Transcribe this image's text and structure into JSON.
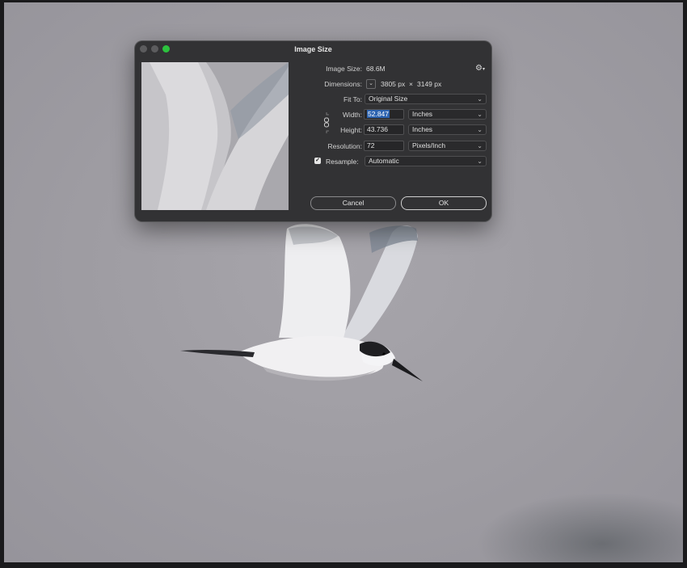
{
  "dialog": {
    "title": "Image Size",
    "image_size_label": "Image Size:",
    "image_size_value": "68.6M",
    "dimensions_label": "Dimensions:",
    "dimensions_width": "3805 px",
    "dimensions_times": "×",
    "dimensions_height": "3149 px",
    "fit_to_label": "Fit To:",
    "fit_to_value": "Original Size",
    "width_label": "Width:",
    "width_value": "52.847",
    "width_unit": "Inches",
    "height_label": "Height:",
    "height_value": "43.736",
    "height_unit": "Inches",
    "resolution_label": "Resolution:",
    "resolution_value": "72",
    "resolution_unit": "Pixels/Inch",
    "resample_label": "Resample:",
    "resample_value": "Automatic",
    "resample_checked": true,
    "cancel_label": "Cancel",
    "ok_label": "OK"
  },
  "icons": {
    "gear": "gear-icon",
    "chevron": "chevron-down-icon",
    "link": "link-chain-icon",
    "check": "checkmark-icon"
  },
  "colors": {
    "dialog_bg": "#323234",
    "selection": "#2c63b0",
    "zoom_button": "#2cc23e",
    "canvas": "#a09ea4"
  }
}
